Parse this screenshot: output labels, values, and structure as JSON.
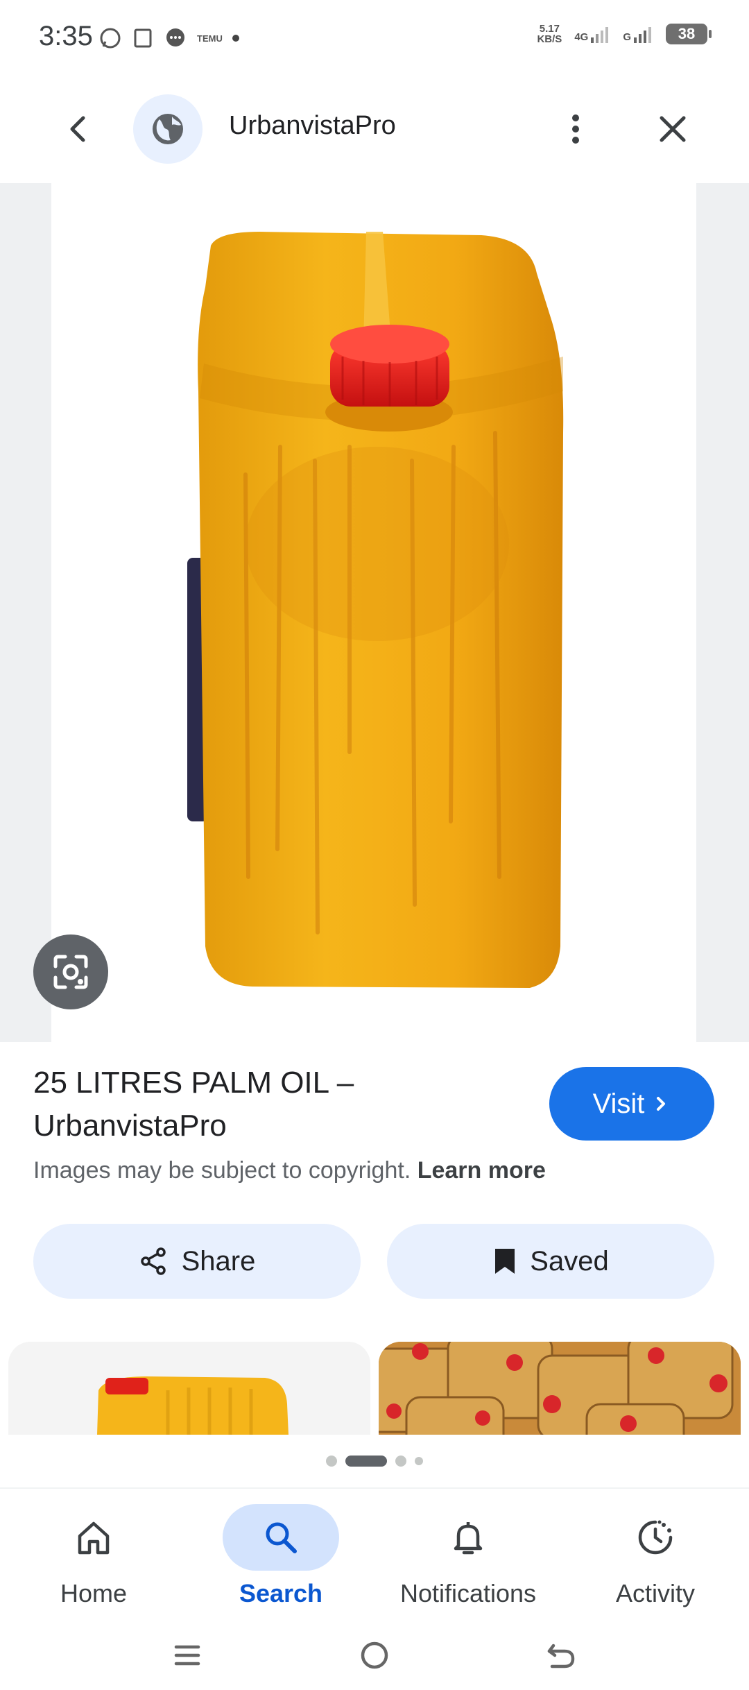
{
  "status_bar": {
    "time": "3:35",
    "notification_label": "TEMU",
    "net_speed_top": "5.17",
    "net_speed_bottom": "KB/S",
    "network_label": "4G",
    "network_label_2": "G",
    "battery": "38"
  },
  "topbar": {
    "site_name": "UrbanvistaPro"
  },
  "result": {
    "title": "25 LITRES PALM OIL – UrbanvistaPro",
    "visit_label": "Visit",
    "copyright_text": "Images may be subject to copyright.",
    "learn_more": "Learn more"
  },
  "actions": {
    "share_label": "Share",
    "saved_label": "Saved"
  },
  "bottom_nav": {
    "items": [
      {
        "label": "Home",
        "icon": "home-icon"
      },
      {
        "label": "Search",
        "icon": "search-icon",
        "active": true
      },
      {
        "label": "Notifications",
        "icon": "bell-icon"
      },
      {
        "label": "Activity",
        "icon": "activity-icon"
      }
    ]
  },
  "colors": {
    "accent": "#1a73e8",
    "active_nav": "#0b57d0",
    "pill": "#e8f0fe",
    "jerrycan": "#f2b417",
    "cap": "#e21c1c"
  }
}
